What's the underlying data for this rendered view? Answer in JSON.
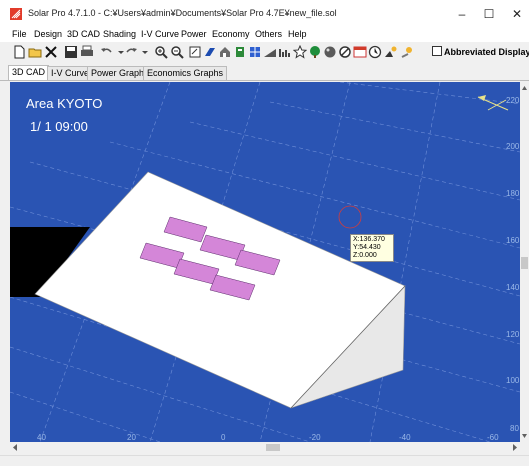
{
  "window": {
    "title": "Solar Pro 4.7.1.0 - C:¥Users¥admin¥Documents¥Solar Pro 4.7E¥new_file.sol",
    "minimize": "–",
    "maximize": "☐",
    "close": "✕"
  },
  "menu": [
    "File",
    "Design",
    "3D CAD",
    "Shading",
    "I-V Curve",
    "Power",
    "Economy",
    "Others",
    "Help"
  ],
  "toolbar": {
    "abbreviated_label": "Abbreviated Display",
    "abbreviated_checked": false
  },
  "tabs": [
    "3D CAD",
    "I-V Curve",
    "Power Graph",
    "Economics Graphs"
  ],
  "view": {
    "area": "Area KYOTO",
    "datetime": "1/ 1 09:00",
    "right_ticks": [
      "220",
      "200",
      "180",
      "160",
      "140",
      "120",
      "100",
      "80"
    ],
    "bottom_ticks": [
      "40",
      "20",
      "0",
      "-20",
      "-40",
      "-60"
    ],
    "cursor": {
      "x": "X:136.370",
      "y": "Y:54.430",
      "z": "Z:0.000"
    }
  },
  "colors": {
    "sky": "#2a54b3",
    "panel": "#d486d8",
    "roof": "#ffffff"
  }
}
